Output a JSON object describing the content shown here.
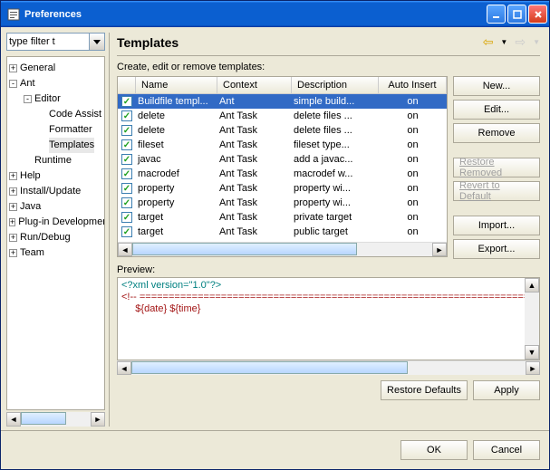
{
  "window": {
    "title": "Preferences"
  },
  "filter": {
    "placeholder": "type filter text",
    "value": "type filter t"
  },
  "tree": [
    {
      "label": "General",
      "twist": "+",
      "depth": 0
    },
    {
      "label": "Ant",
      "twist": "-",
      "depth": 0
    },
    {
      "label": "Editor",
      "twist": "-",
      "depth": 1
    },
    {
      "label": "Code Assist",
      "twist": "",
      "depth": 2
    },
    {
      "label": "Formatter",
      "twist": "",
      "depth": 2
    },
    {
      "label": "Templates",
      "twist": "",
      "depth": 2,
      "selected": true
    },
    {
      "label": "Runtime",
      "twist": "",
      "depth": 1
    },
    {
      "label": "Help",
      "twist": "+",
      "depth": 0
    },
    {
      "label": "Install/Update",
      "twist": "+",
      "depth": 0
    },
    {
      "label": "Java",
      "twist": "+",
      "depth": 0
    },
    {
      "label": "Plug-in Development",
      "twist": "+",
      "depth": 0
    },
    {
      "label": "Run/Debug",
      "twist": "+",
      "depth": 0
    },
    {
      "label": "Team",
      "twist": "+",
      "depth": 0
    }
  ],
  "page": {
    "title": "Templates",
    "instruction": "Create, edit or remove templates:",
    "previewLabel": "Preview:"
  },
  "columns": {
    "name": "Name",
    "context": "Context",
    "description": "Description",
    "autoinsert": "Auto Insert"
  },
  "rows": [
    {
      "name": "Buildfile templ...",
      "context": "Ant",
      "desc": "simple build...",
      "ai": "on",
      "selected": true
    },
    {
      "name": "delete",
      "context": "Ant Task",
      "desc": "delete files ...",
      "ai": "on"
    },
    {
      "name": "delete",
      "context": "Ant Task",
      "desc": "delete files ...",
      "ai": "on"
    },
    {
      "name": "fileset",
      "context": "Ant Task",
      "desc": "fileset type...",
      "ai": "on"
    },
    {
      "name": "javac",
      "context": "Ant Task",
      "desc": "add a javac...",
      "ai": "on"
    },
    {
      "name": "macrodef",
      "context": "Ant Task",
      "desc": "macrodef w...",
      "ai": "on"
    },
    {
      "name": "property",
      "context": "Ant Task",
      "desc": "property wi...",
      "ai": "on"
    },
    {
      "name": "property",
      "context": "Ant Task",
      "desc": "property wi...",
      "ai": "on"
    },
    {
      "name": "target",
      "context": "Ant Task",
      "desc": "private target",
      "ai": "on"
    },
    {
      "name": "target",
      "context": "Ant Task",
      "desc": "public target",
      "ai": "on"
    }
  ],
  "buttons": {
    "new": "New...",
    "edit": "Edit...",
    "remove": "Remove",
    "restoreRemoved": "Restore Removed",
    "revert": "Revert to Default",
    "import": "Import...",
    "export": "Export...",
    "restoreDefaults": "Restore Defaults",
    "apply": "Apply",
    "ok": "OK",
    "cancel": "Cancel"
  },
  "preview": {
    "line1": "<?xml version=\"1.0\"?>",
    "line2open": "<!-- ",
    "line2pad": "======================================================================",
    "line3": "     ${date} ${time}"
  }
}
